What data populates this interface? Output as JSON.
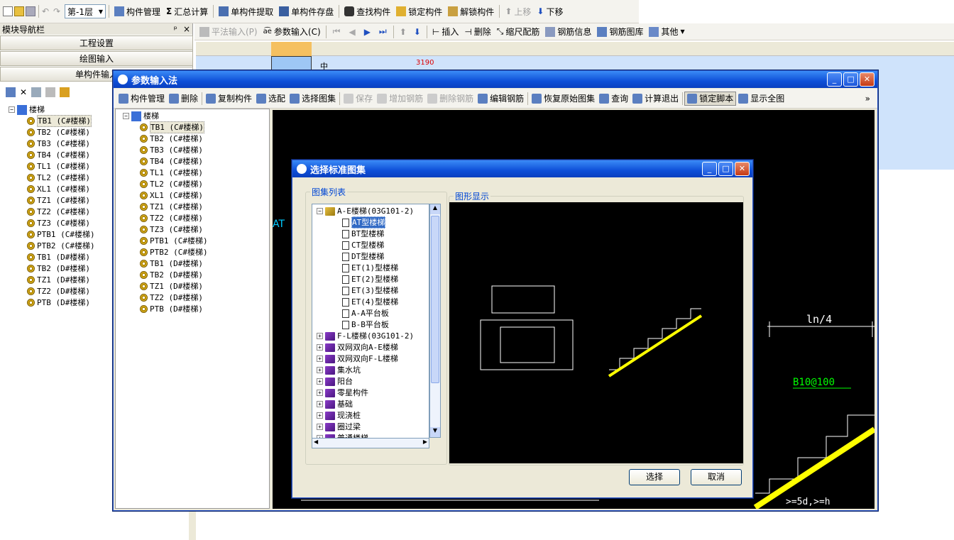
{
  "main_toolbar": {
    "floor": "第-1层",
    "items": [
      "构件管理",
      "汇总计算",
      "单构件提取",
      "单构件存盘",
      "查找构件",
      "锁定构件",
      "解锁构件",
      "上移",
      "下移"
    ]
  },
  "module_nav": {
    "title": "模块导航栏",
    "sections": [
      "工程设置",
      "绘图输入",
      "单构件输入"
    ]
  },
  "left_tree": {
    "root": "楼梯",
    "items": [
      "TB1 (C#楼梯)",
      "TB2 (C#楼梯)",
      "TB3 (C#楼梯)",
      "TB4 (C#楼梯)",
      "TL1 (C#楼梯)",
      "TL2 (C#楼梯)",
      "XL1 (C#楼梯)",
      "TZ1 (C#楼梯)",
      "TZ2 (C#楼梯)",
      "TZ3 (C#楼梯)",
      "PTB1 (C#楼梯)",
      "PTB2 (C#楼梯)",
      "TB1 (D#楼梯)",
      "TB2 (D#楼梯)",
      "TZ1 (D#楼梯)",
      "TZ2 (D#楼梯)",
      "PTB (D#楼梯)"
    ]
  },
  "sub_toolbar": {
    "items": [
      "平法输入(P)",
      "参数输入(C)",
      "插入",
      "删除",
      "缩尺配筋",
      "钢筋信息",
      "钢筋图库",
      "其他"
    ]
  },
  "grid": {
    "cell_text": "3190",
    "side_char": "中"
  },
  "param_window": {
    "title": "参数输入法",
    "toolbar": [
      "构件管理",
      "删除",
      "复制构件",
      "选配",
      "选择图集",
      "保存",
      "增加钢筋",
      "删除钢筋",
      "编辑钢筋",
      "恢复原始图集",
      "查询",
      "计算退出",
      "锁定脚本",
      "显示全图"
    ],
    "more": "»",
    "tree_root": "楼梯",
    "tree_items": [
      "TB1 (C#楼梯)",
      "TB2 (C#楼梯)",
      "TB3 (C#楼梯)",
      "TB4 (C#楼梯)",
      "TL1 (C#楼梯)",
      "TL2 (C#楼梯)",
      "XL1 (C#楼梯)",
      "TZ1 (C#楼梯)",
      "TZ2 (C#楼梯)",
      "TZ3 (C#楼梯)",
      "PTB1 (C#楼梯)",
      "PTB2 (C#楼梯)",
      "TB1 (D#楼梯)",
      "TB2 (D#楼梯)",
      "TZ1 (D#楼梯)",
      "TZ2 (D#楼梯)",
      "PTB (D#楼梯)"
    ],
    "cad_labels": {
      "ln4": "ln/4",
      "b10": "B10@100",
      "dim": ">=5d,>=h",
      "at": "AT"
    }
  },
  "dialog": {
    "title": "选择标准图集",
    "list_label": "图集列表",
    "preview_label": "图形显示",
    "group1": "A-E楼梯(03G101-2)",
    "group1_items": [
      "AT型楼梯",
      "BT型楼梯",
      "CT型楼梯",
      "DT型楼梯",
      "ET(1)型楼梯",
      "ET(2)型楼梯",
      "ET(3)型楼梯",
      "ET(4)型楼梯",
      "A-A平台板",
      "B-B平台板"
    ],
    "groups": [
      "F-L楼梯(03G101-2)",
      "双网双向A-E楼梯",
      "双网双向F-L楼梯",
      "集水坑",
      "阳台",
      "零星构件",
      "基础",
      "现浇桩",
      "圈过梁",
      "普通楼梯"
    ],
    "ok": "选择",
    "cancel": "取消"
  },
  "colors": {
    "title_blue": "#0e4fd8",
    "selection": "#316ac5",
    "cad_bg": "#000000",
    "cad_yellow": "#ffff00",
    "cad_green": "#00ff00"
  }
}
